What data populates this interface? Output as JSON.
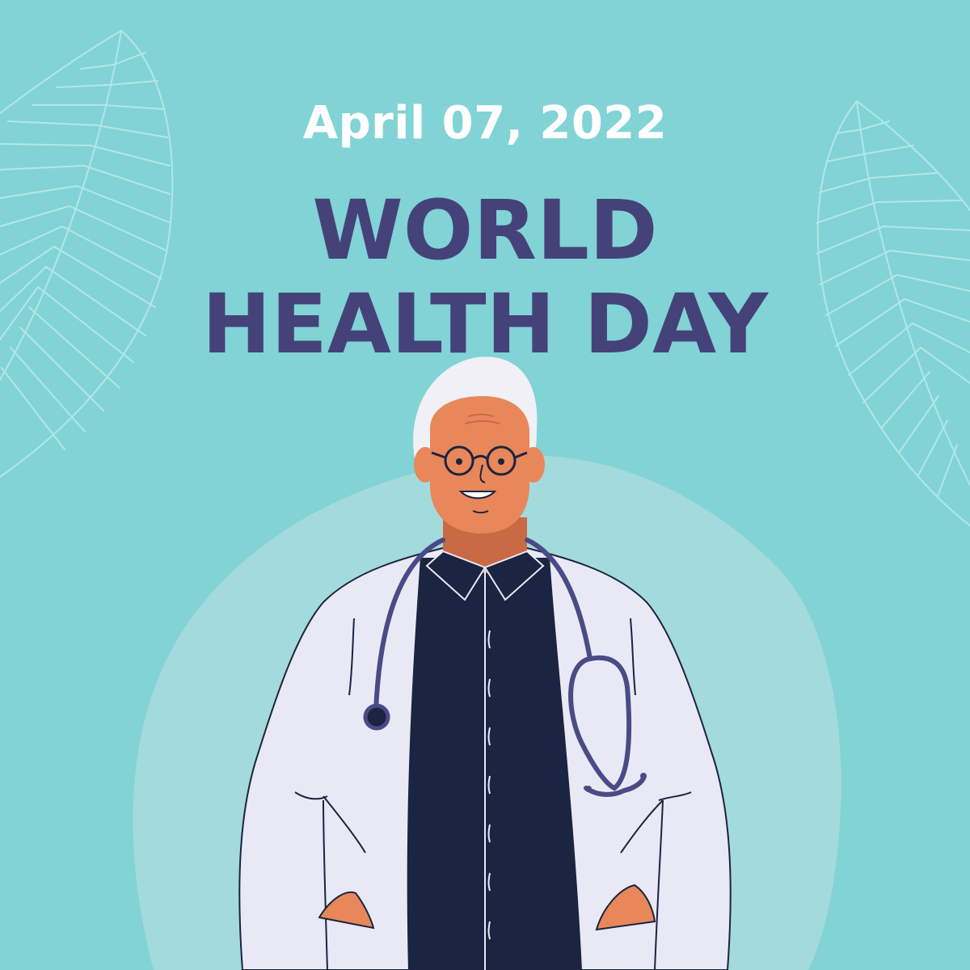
{
  "poster": {
    "date": "April 07, 2022",
    "title_line1": "WORLD",
    "title_line2": "HEALTH DAY"
  },
  "colors": {
    "background": "#82d3d6",
    "blob": "#a3dadc",
    "leaf_line": "#b3e6e6",
    "title": "#45427a",
    "date": "#ffffff",
    "coat": "#e9e9f5",
    "shirt": "#1b2440",
    "skin": "#e8875a",
    "hair": "#f0f0f6",
    "stethoscope": "#4a4a86"
  },
  "icons": [
    "leaf-left-icon",
    "leaf-right-icon",
    "doctor-illustration"
  ]
}
